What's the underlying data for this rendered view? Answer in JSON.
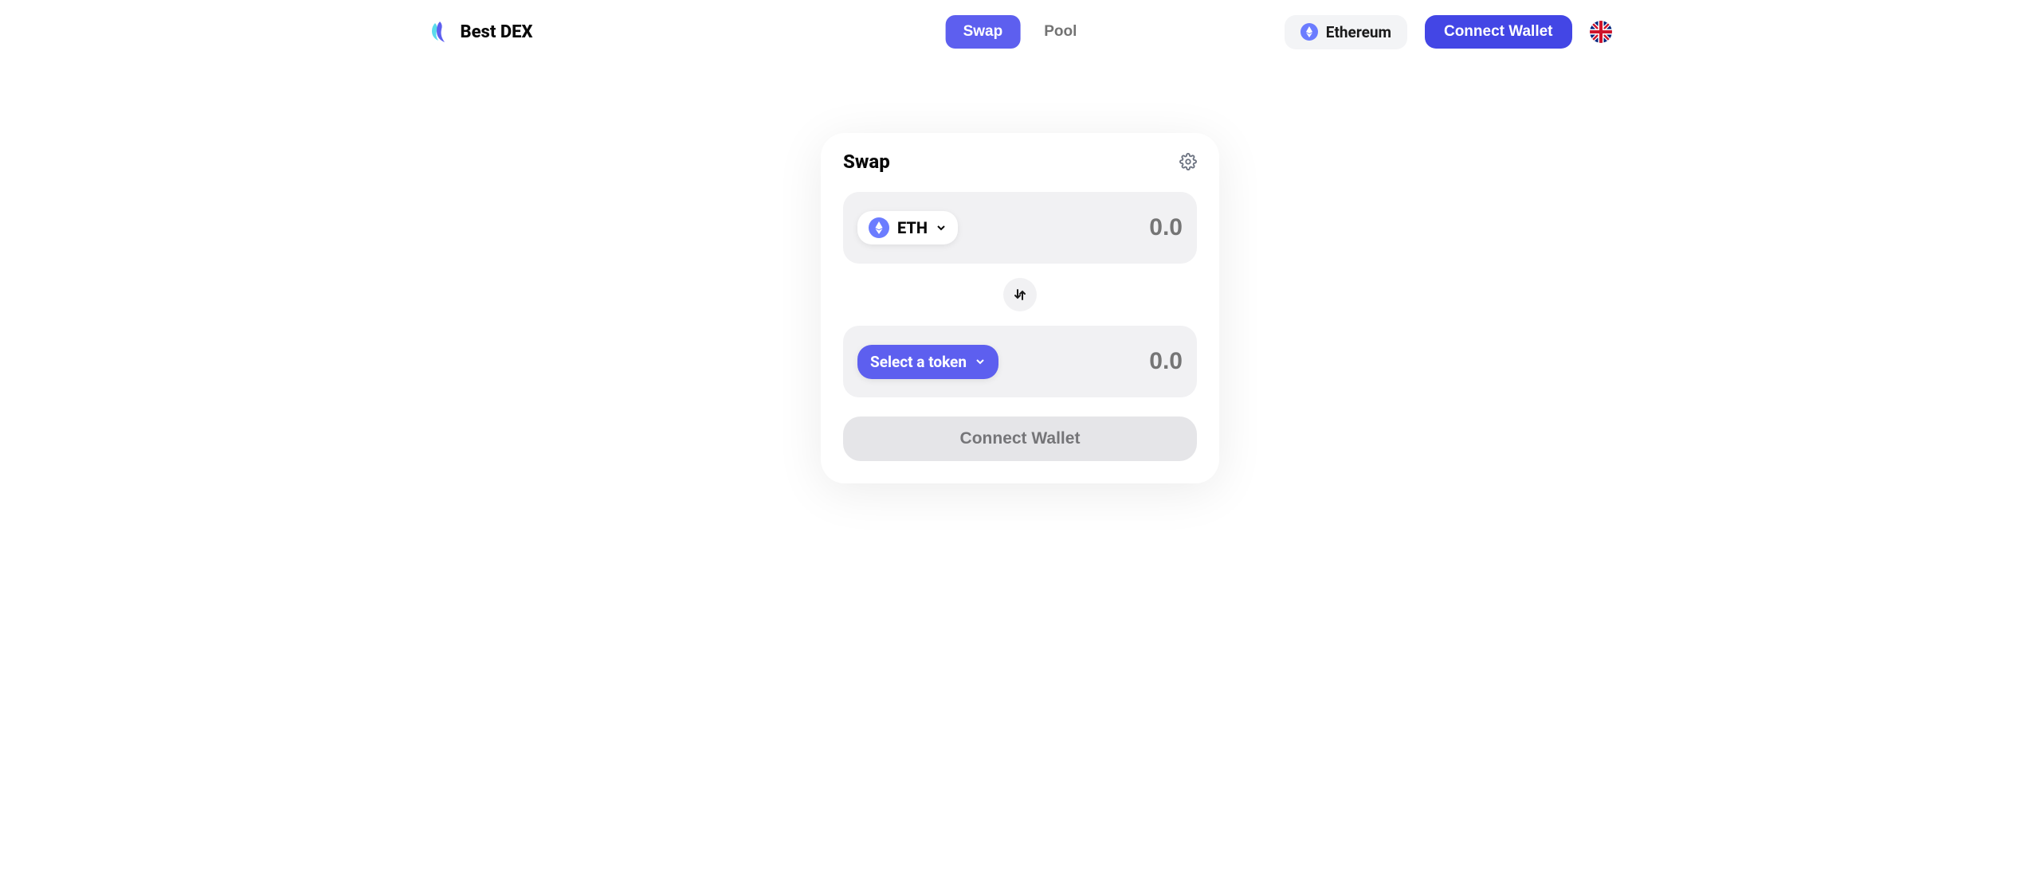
{
  "header": {
    "logo_text": "Best DEX",
    "nav": {
      "swap": "Swap",
      "pool": "Pool"
    },
    "network": {
      "label": "Ethereum"
    },
    "connect_button": "Connect Wallet"
  },
  "swap": {
    "title": "Swap",
    "from": {
      "token_symbol": "ETH",
      "amount_placeholder": "0.0"
    },
    "to": {
      "select_label": "Select a token",
      "amount_placeholder": "0.0"
    },
    "action_button": "Connect Wallet"
  }
}
